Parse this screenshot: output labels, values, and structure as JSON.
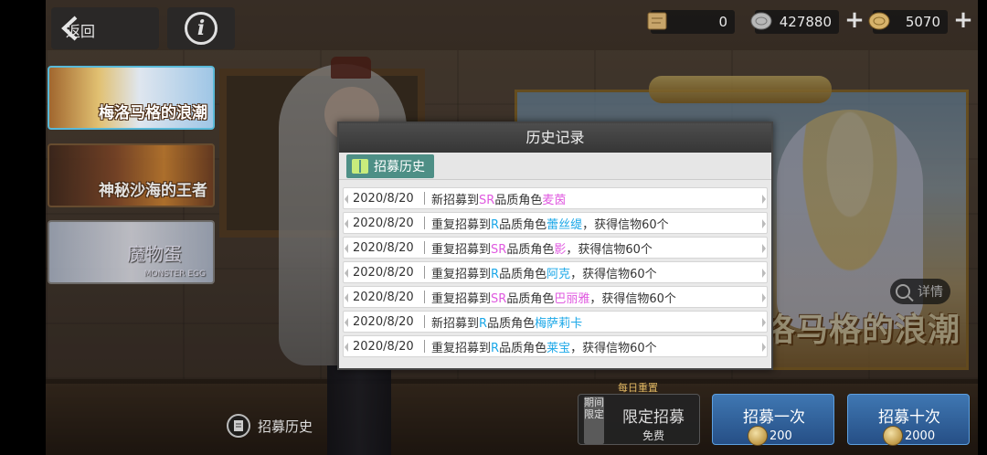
{
  "topbar": {
    "back_label": "返回",
    "resources": [
      {
        "name": "scroll-ticket",
        "value": "0"
      },
      {
        "name": "silver-coin",
        "value": "427880"
      },
      {
        "name": "gold-coin",
        "value": "5070"
      }
    ]
  },
  "side_banners": [
    {
      "label": "梅洛马格的浪潮"
    },
    {
      "label": "神秘沙海的王者"
    },
    {
      "label": "魔物蛋",
      "sub": "MONSTER EGG"
    }
  ],
  "featured_banner": {
    "title": "洛马格的浪潮",
    "details_label": "详情"
  },
  "bottom": {
    "history_link": "招募历史",
    "daily_reset": "每日重置",
    "limited": {
      "tag": "期间限定",
      "title": "限定招募",
      "sub": "免费"
    },
    "pull_once": {
      "label": "招募一次",
      "cost": "200"
    },
    "pull_ten": {
      "label": "招募十次",
      "cost": "2000"
    }
  },
  "modal": {
    "title": "历史记录",
    "tab": "招募历史",
    "rows": [
      {
        "date": "2020/8/20",
        "prefix": "新招募到",
        "rarity": "SR",
        "mid": "品质角色",
        "name": "麦茵",
        "suffix": ""
      },
      {
        "date": "2020/8/20",
        "prefix": "重复招募到",
        "rarity": "R",
        "mid": "品质角色",
        "name": "蕾丝缇",
        "suffix": "，获得信物60个"
      },
      {
        "date": "2020/8/20",
        "prefix": "重复招募到",
        "rarity": "SR",
        "mid": "品质角色",
        "name": "影",
        "suffix": "，获得信物60个"
      },
      {
        "date": "2020/8/20",
        "prefix": "重复招募到",
        "rarity": "R",
        "mid": "品质角色",
        "name": "阿克",
        "suffix": "，获得信物60个"
      },
      {
        "date": "2020/8/20",
        "prefix": "重复招募到",
        "rarity": "SR",
        "mid": "品质角色",
        "name": "巴丽雅",
        "suffix": "，获得信物60个"
      },
      {
        "date": "2020/8/20",
        "prefix": "新招募到",
        "rarity": "R",
        "mid": "品质角色",
        "name": "梅萨莉卡",
        "suffix": ""
      },
      {
        "date": "2020/8/20",
        "prefix": "重复招募到",
        "rarity": "R",
        "mid": "品质角色",
        "name": "莱宝",
        "suffix": "，获得信物60个"
      }
    ]
  },
  "colors": {
    "sr": "#e05ae0",
    "r": "#1ca8e8",
    "tab": "#4e8f86"
  }
}
